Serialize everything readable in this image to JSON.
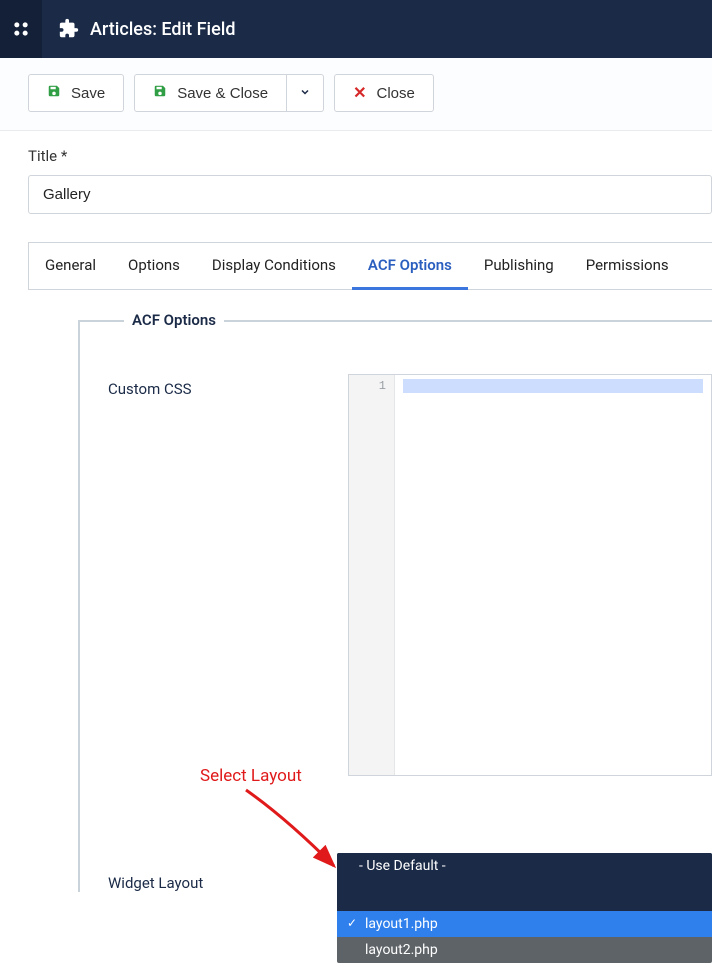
{
  "header": {
    "app_title": "Articles: Edit Field"
  },
  "toolbar": {
    "save_label": "Save",
    "save_close_label": "Save & Close",
    "close_label": "Close"
  },
  "title_field": {
    "label": "Title *",
    "value": "Gallery"
  },
  "tabs": [
    {
      "label": "General"
    },
    {
      "label": "Options"
    },
    {
      "label": "Display Conditions"
    },
    {
      "label": "ACF Options"
    },
    {
      "label": "Publishing"
    },
    {
      "label": "Permissions"
    }
  ],
  "fieldset": {
    "legend": "ACF Options",
    "custom_css_label": "Custom CSS",
    "gutter_line": "1",
    "widget_layout_label": "Widget Layout"
  },
  "dropdown": {
    "group_label": "- Use Default -",
    "option_selected": "layout1.php",
    "option_other": "layout2.php"
  },
  "annotation": {
    "text": "Select Layout"
  }
}
